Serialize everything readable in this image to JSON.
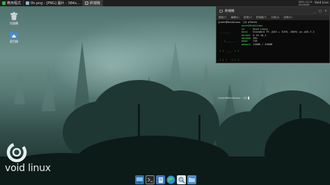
{
  "top_panel": {
    "apps_label": "應用程式",
    "tasks": [
      {
        "label": "0h.png - [PNG] 圖片 - 384x...",
        "icon": "image-icon"
      },
      {
        "label": "終端機",
        "icon": "terminal-icon"
      }
    ],
    "clock_date": "2021.12.21",
    "clock_time": "01:00:00",
    "user": "Void Live"
  },
  "desktop_icons": [
    {
      "name": "trash",
      "label": "垃圾桶",
      "icon": "trash-icon"
    },
    {
      "name": "home",
      "label": "家目錄",
      "icon": "home-folder-icon"
    }
  ],
  "logo": {
    "text": "void linux"
  },
  "terminal": {
    "title": "終端機",
    "menu": [
      "檔案(F)",
      "編輯(E)",
      "檢視(V)",
      "終端機(T)",
      "分頁(A)",
      "說明(H)"
    ],
    "prompt_cmd": "[user@VoidLinux ~]$ pfetch",
    "fetch_header": "user@VoidLinux",
    "fetch_art": [
      " _______",
      "  _ \\______ -",
      " | \\  ___  \\ |",
      " | | /   \\ | |",
      " | | \\___/ | |",
      " | \\______ \\_|",
      "  -_______\\"
    ],
    "fetch_rows": [
      {
        "key": "os",
        "value": "Void Linux"
      },
      {
        "key": "host",
        "value": "Standard PC (Q35 + ICH9, 2009) pc-q35-7.2"
      },
      {
        "key": "kernel",
        "value": "5.19.10_1"
      },
      {
        "key": "uptime",
        "value": "19m"
      },
      {
        "key": "pkgs",
        "value": "718"
      },
      {
        "key": "memory",
        "value": "1180M / 3968M"
      }
    ],
    "prompt_end": "[user@VoidLinux ~]$ "
  },
  "dock": {
    "items": [
      "show-desktop-icon",
      "terminal-icon",
      "files-icon",
      "browser-icon",
      "search-icon",
      "folder-icon"
    ]
  },
  "colors": {
    "void_green": "#3bb34a",
    "panel_bg": "#1f1f1f",
    "terminal_bg": "#0a0a0a"
  }
}
